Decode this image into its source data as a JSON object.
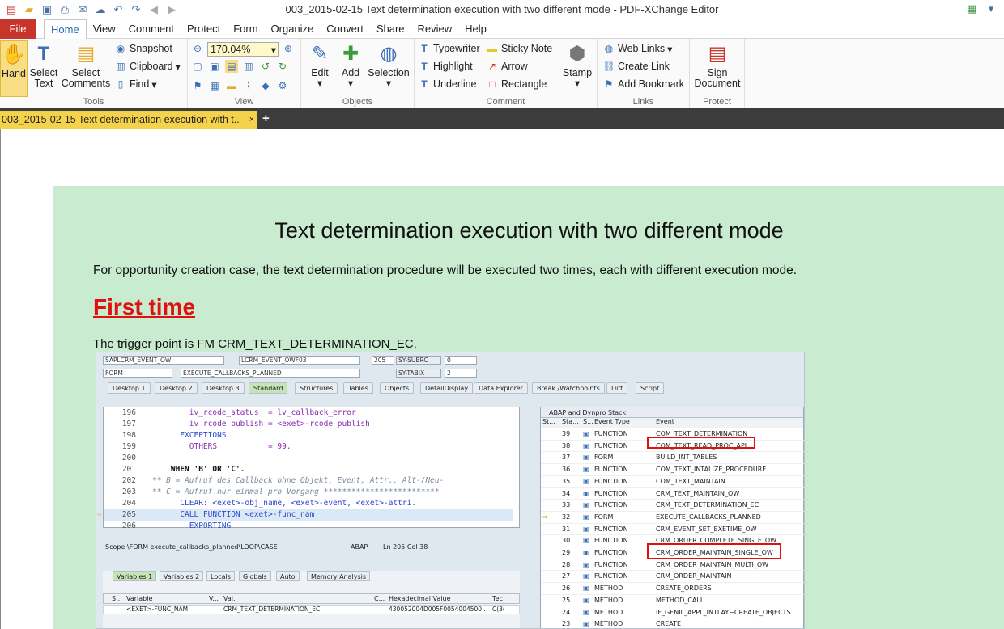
{
  "window": {
    "title": "003_2015-02-15 Text determination execution with two different mode - PDF-XChange Editor"
  },
  "menu": {
    "file": "File",
    "tabs": [
      "Home",
      "View",
      "Comment",
      "Protect",
      "Form",
      "Organize",
      "Convert",
      "Share",
      "Review",
      "Help"
    ],
    "active": "Home"
  },
  "ribbon": {
    "tools": {
      "hand": "Hand",
      "select_text_1": "Select",
      "select_text_2": "Text",
      "select_comments_1": "Select",
      "select_comments_2": "Comments",
      "snapshot": "Snapshot",
      "clipboard": "Clipboard",
      "find": "Find",
      "label": "Tools"
    },
    "view": {
      "zoom": "170.04%",
      "label": "View"
    },
    "objects": {
      "edit": "Edit",
      "add": "Add",
      "selection": "Selection",
      "label": "Objects"
    },
    "comment": {
      "typewriter": "Typewriter",
      "sticky_note": "Sticky Note",
      "highlight": "Highlight",
      "arrow": "Arrow",
      "underline": "Underline",
      "rectangle": "Rectangle",
      "stamp": "Stamp",
      "label": "Comment"
    },
    "links": {
      "web_links": "Web Links",
      "create_link": "Create Link",
      "add_bookmark": "Add Bookmark",
      "label": "Links"
    },
    "protect": {
      "sign_1": "Sign",
      "sign_2": "Document",
      "label": "Protect"
    }
  },
  "doc_tab": {
    "title": "003_2015-02-15 Text determination execution with t..",
    "close": "×",
    "new": "+"
  },
  "page": {
    "title": "Text determination execution with two different mode",
    "intro": "For opportunity creation case, the text determination procedure will be executed two times, each with different execution mode.",
    "heading": "First time",
    "trigger": "The trigger point is FM CRM_TEXT_DETERMINATION_EC,"
  },
  "sap": {
    "fields": {
      "prog": "SAPLCRM_EVENT_OW",
      "incl": "LCRM_EVENT_OWF03",
      "line": "205",
      "subrc_label": "SY-SUBRC",
      "subrc": "0",
      "type": "FORM",
      "name": "EXECUTE_CALLBACKS_PLANNED",
      "tabix_label": "SY-TABIX",
      "tabix": "2"
    },
    "tabs": [
      "Desktop 1",
      "Desktop 2",
      "Desktop 3",
      "Standard",
      "Structures",
      "Tables",
      "Objects",
      "DetailDisplay",
      "Data Explorer",
      "Break./Watchpoints",
      "Diff",
      "Script"
    ],
    "code": [
      {
        "ln": "196",
        "txt": "        iv_rcode_status  = lv_callback_error"
      },
      {
        "ln": "197",
        "txt": "        iv_rcode_publish = <exet>-rcode_publish"
      },
      {
        "ln": "198",
        "txt": "      EXCEPTIONS"
      },
      {
        "ln": "199",
        "txt": "        OTHERS           = 99."
      },
      {
        "ln": "200",
        "txt": ""
      },
      {
        "ln": "201",
        "txt": "    WHEN 'B' OR 'C'."
      },
      {
        "ln": "202",
        "txt": "** B = Aufruf des Callback ohne Objekt, Event, Attr., Alt-/Neu-"
      },
      {
        "ln": "203",
        "txt": "** C = Aufruf nur einmal pro Vorgang *************************"
      },
      {
        "ln": "204",
        "txt": "      CLEAR: <exet>-obj_name, <exet>-event, <exet>-attri."
      },
      {
        "ln": "205",
        "txt": "      CALL FUNCTION <exet>-func_nam"
      },
      {
        "ln": "206",
        "txt": "        EXPORTING"
      }
    ],
    "scope": "Scope \\FORM execute_callbacks_planned\\LOOP\\CASE",
    "abap": "ABAP",
    "lncol": "Ln 205 Col 38",
    "stack_title": "ABAP and Dynpro Stack",
    "stack_headers": [
      "St...",
      "Sta...",
      "S...",
      "Event Type",
      "Event"
    ],
    "stack": [
      {
        "n": "39",
        "t": "FUNCTION",
        "e": "COM_TEXT_DETERMINATION"
      },
      {
        "n": "38",
        "t": "FUNCTION",
        "e": "COM_TEXT_READ_PROC_API"
      },
      {
        "n": "37",
        "t": "FORM",
        "e": "BUILD_INT_TABLES"
      },
      {
        "n": "36",
        "t": "FUNCTION",
        "e": "COM_TEXT_INTALIZE_PROCEDURE"
      },
      {
        "n": "35",
        "t": "FUNCTION",
        "e": "COM_TEXT_MAINTAIN"
      },
      {
        "n": "34",
        "t": "FUNCTION",
        "e": "CRM_TEXT_MAINTAIN_OW"
      },
      {
        "n": "33",
        "t": "FUNCTION",
        "e": "CRM_TEXT_DETERMINATION_EC"
      },
      {
        "n": "32",
        "t": "FORM",
        "e": "EXECUTE_CALLBACKS_PLANNED"
      },
      {
        "n": "31",
        "t": "FUNCTION",
        "e": "CRM_EVENT_SET_EXETIME_OW"
      },
      {
        "n": "30",
        "t": "FUNCTION",
        "e": "CRM_ORDER_COMPLETE_SINGLE_OW"
      },
      {
        "n": "29",
        "t": "FUNCTION",
        "e": "CRM_ORDER_MAINTAIN_SINGLE_OW"
      },
      {
        "n": "28",
        "t": "FUNCTION",
        "e": "CRM_ORDER_MAINTAIN_MULTI_OW"
      },
      {
        "n": "27",
        "t": "FUNCTION",
        "e": "CRM_ORDER_MAINTAIN"
      },
      {
        "n": "26",
        "t": "METHOD",
        "e": "CREATE_ORDERS"
      },
      {
        "n": "25",
        "t": "METHOD",
        "e": "METHOD_CALL"
      },
      {
        "n": "24",
        "t": "METHOD",
        "e": "IF_GENIL_APPL_INTLAY~CREATE_OBJECTS"
      },
      {
        "n": "23",
        "t": "METHOD",
        "e": "CREATE"
      }
    ],
    "var_tabs": [
      "Variables 1",
      "Variables 2",
      "Locals",
      "Globals",
      "Auto",
      "Memory Analysis"
    ],
    "var_headers": [
      "S...",
      "Variable",
      "V...",
      "Val.",
      "C...",
      "Hexadecimal Value",
      "Tec"
    ],
    "var_row": {
      "variable": "<EXET>-FUNC_NAM",
      "value": "CRM_TEXT_DETERMINATION_EC",
      "hex": "430052004D005F0054004500..",
      "tec": "C(3("
    }
  }
}
